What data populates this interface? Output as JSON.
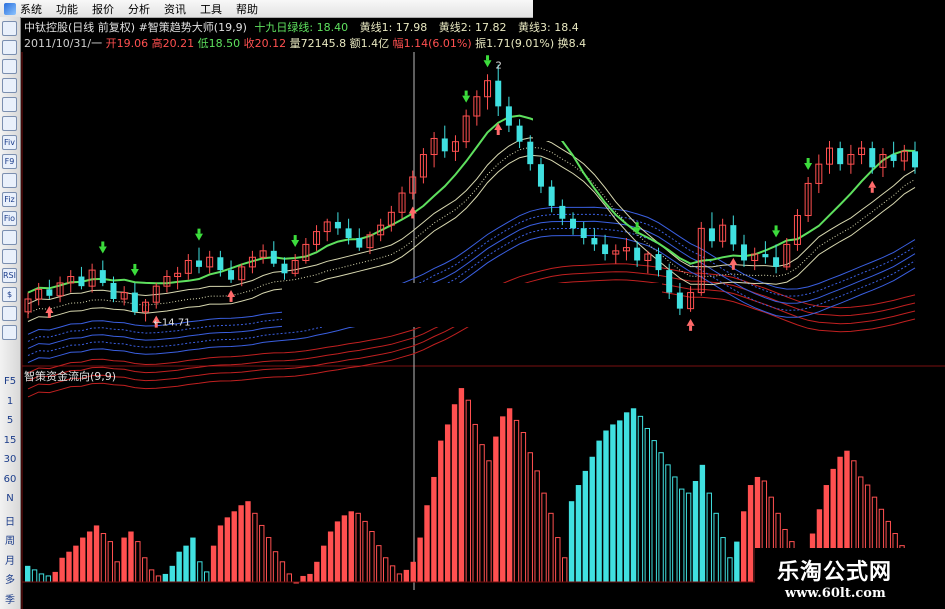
{
  "menu": {
    "items": [
      "系统",
      "功能",
      "报价",
      "分析",
      "资讯",
      "工具",
      "帮助"
    ]
  },
  "toolbar": {
    "labels": [
      "F5",
      "1",
      "5",
      "15",
      "30",
      "60",
      "N",
      "日",
      "周",
      "月",
      "多",
      "季"
    ],
    "icon_text": [
      "",
      "",
      "",
      "",
      "",
      "",
      "Fiv",
      "F9",
      "",
      "Fiz",
      "Fio",
      "",
      "",
      "RSI",
      "$",
      "",
      ""
    ]
  },
  "header": {
    "line1": {
      "stock": "中钛控股(日线 前复权)",
      "indicator": "#智策趋势大师(19,9)",
      "green_line": "十九日绿线: 18.40",
      "yellow1": "黄线1: 17.98",
      "yellow2": "黄线2: 17.82",
      "yellow3": "黄线3: 18.4"
    },
    "line2": {
      "date": "2011/10/31/一",
      "open": "开19.06",
      "high": "高20.21",
      "low": "低18.50",
      "close": "收20.12",
      "volume": "量72145.8",
      "amount": "额1.4亿",
      "change": "幅1.14(6.01%)",
      "amplitude": "振1.71(9.01%)",
      "turnover": "换8.4"
    }
  },
  "lower_panel": {
    "title": "智策资金流向(9,9)"
  },
  "annotations": {
    "low_price": "14.71",
    "high_price_partial": "2"
  },
  "watermark": {
    "title": "乐淘公式网",
    "url": "www.60lt.com"
  },
  "colors": {
    "up": "#ff5050",
    "down": "#40e0e0",
    "green_line": "#5ee05e",
    "yellow_line": "#d8d8b0",
    "blue_band": "#3a5fe0",
    "red_band": "#c02020",
    "arrow_down": "#3cdc3c",
    "arrow_up": "#ff6a6a"
  },
  "chart_data": [
    {
      "type": "candlestick",
      "title": "#智策趋势大师(19,9)",
      "ylim": [
        13.5,
        23
      ],
      "candles": [
        {
          "o": 15.0,
          "h": 15.6,
          "l": 14.8,
          "c": 15.4
        },
        {
          "o": 15.4,
          "h": 15.9,
          "l": 15.2,
          "c": 15.7
        },
        {
          "o": 15.7,
          "h": 16.0,
          "l": 15.4,
          "c": 15.5
        },
        {
          "o": 15.5,
          "h": 16.1,
          "l": 15.3,
          "c": 15.9
        },
        {
          "o": 15.9,
          "h": 16.3,
          "l": 15.6,
          "c": 16.1
        },
        {
          "o": 16.1,
          "h": 16.4,
          "l": 15.7,
          "c": 15.8
        },
        {
          "o": 15.8,
          "h": 16.5,
          "l": 15.6,
          "c": 16.3
        },
        {
          "o": 16.3,
          "h": 16.6,
          "l": 15.8,
          "c": 15.9
        },
        {
          "o": 15.9,
          "h": 16.1,
          "l": 15.3,
          "c": 15.4
        },
        {
          "o": 15.4,
          "h": 15.8,
          "l": 15.2,
          "c": 15.6
        },
        {
          "o": 15.6,
          "h": 15.9,
          "l": 14.9,
          "c": 15.0
        },
        {
          "o": 15.0,
          "h": 15.4,
          "l": 14.7,
          "c": 15.3
        },
        {
          "o": 15.3,
          "h": 15.9,
          "l": 15.1,
          "c": 15.8
        },
        {
          "o": 15.8,
          "h": 16.3,
          "l": 15.6,
          "c": 16.1
        },
        {
          "o": 16.1,
          "h": 16.4,
          "l": 15.7,
          "c": 16.2
        },
        {
          "o": 16.2,
          "h": 16.8,
          "l": 16.0,
          "c": 16.6
        },
        {
          "o": 16.6,
          "h": 17.0,
          "l": 16.2,
          "c": 16.4
        },
        {
          "o": 16.4,
          "h": 16.9,
          "l": 16.2,
          "c": 16.7
        },
        {
          "o": 16.7,
          "h": 16.9,
          "l": 16.1,
          "c": 16.3
        },
        {
          "o": 16.3,
          "h": 16.6,
          "l": 15.9,
          "c": 16.0
        },
        {
          "o": 16.0,
          "h": 16.5,
          "l": 15.8,
          "c": 16.4
        },
        {
          "o": 16.4,
          "h": 16.9,
          "l": 16.2,
          "c": 16.7
        },
        {
          "o": 16.7,
          "h": 17.1,
          "l": 16.5,
          "c": 16.9
        },
        {
          "o": 16.9,
          "h": 17.2,
          "l": 16.4,
          "c": 16.5
        },
        {
          "o": 16.5,
          "h": 16.7,
          "l": 16.0,
          "c": 16.2
        },
        {
          "o": 16.2,
          "h": 16.8,
          "l": 16.1,
          "c": 16.6
        },
        {
          "o": 16.6,
          "h": 17.3,
          "l": 16.5,
          "c": 17.1
        },
        {
          "o": 17.1,
          "h": 17.7,
          "l": 16.9,
          "c": 17.5
        },
        {
          "o": 17.5,
          "h": 17.9,
          "l": 17.2,
          "c": 17.8
        },
        {
          "o": 17.8,
          "h": 18.1,
          "l": 17.4,
          "c": 17.6
        },
        {
          "o": 17.6,
          "h": 17.9,
          "l": 17.1,
          "c": 17.3
        },
        {
          "o": 17.3,
          "h": 17.6,
          "l": 16.9,
          "c": 17.0
        },
        {
          "o": 17.0,
          "h": 17.5,
          "l": 16.8,
          "c": 17.4
        },
        {
          "o": 17.4,
          "h": 17.9,
          "l": 17.2,
          "c": 17.7
        },
        {
          "o": 17.7,
          "h": 18.3,
          "l": 17.5,
          "c": 18.1
        },
        {
          "o": 18.1,
          "h": 18.9,
          "l": 17.9,
          "c": 18.7
        },
        {
          "o": 18.7,
          "h": 19.4,
          "l": 18.5,
          "c": 19.2
        },
        {
          "o": 19.2,
          "h": 20.1,
          "l": 19.0,
          "c": 19.9
        },
        {
          "o": 19.9,
          "h": 20.6,
          "l": 19.5,
          "c": 20.4
        },
        {
          "o": 20.4,
          "h": 20.8,
          "l": 19.8,
          "c": 20.0
        },
        {
          "o": 20.0,
          "h": 20.5,
          "l": 19.7,
          "c": 20.3
        },
        {
          "o": 20.3,
          "h": 21.3,
          "l": 20.1,
          "c": 21.1
        },
        {
          "o": 21.1,
          "h": 21.9,
          "l": 20.8,
          "c": 21.7
        },
        {
          "o": 21.7,
          "h": 22.4,
          "l": 21.3,
          "c": 22.2
        },
        {
          "o": 22.2,
          "h": 22.7,
          "l": 21.1,
          "c": 21.4
        },
        {
          "o": 21.4,
          "h": 21.7,
          "l": 20.6,
          "c": 20.8
        },
        {
          "o": 20.8,
          "h": 21.0,
          "l": 20.1,
          "c": 20.3
        },
        {
          "o": 20.3,
          "h": 20.5,
          "l": 19.4,
          "c": 19.6
        },
        {
          "o": 19.6,
          "h": 19.8,
          "l": 18.7,
          "c": 18.9
        },
        {
          "o": 18.9,
          "h": 19.1,
          "l": 18.1,
          "c": 18.3
        },
        {
          "o": 18.3,
          "h": 18.5,
          "l": 17.7,
          "c": 17.9
        },
        {
          "o": 17.9,
          "h": 18.1,
          "l": 17.4,
          "c": 17.6
        },
        {
          "o": 17.6,
          "h": 17.8,
          "l": 17.1,
          "c": 17.3
        },
        {
          "o": 17.3,
          "h": 17.6,
          "l": 16.9,
          "c": 17.1
        },
        {
          "o": 17.1,
          "h": 17.4,
          "l": 16.6,
          "c": 16.8
        },
        {
          "o": 16.8,
          "h": 17.1,
          "l": 16.5,
          "c": 16.9
        },
        {
          "o": 16.9,
          "h": 17.3,
          "l": 16.6,
          "c": 17.0
        },
        {
          "o": 17.0,
          "h": 17.2,
          "l": 16.4,
          "c": 16.6
        },
        {
          "o": 16.6,
          "h": 16.9,
          "l": 16.2,
          "c": 16.8
        },
        {
          "o": 16.8,
          "h": 17.0,
          "l": 16.1,
          "c": 16.3
        },
        {
          "o": 16.3,
          "h": 16.5,
          "l": 15.4,
          "c": 15.6
        },
        {
          "o": 15.6,
          "h": 15.9,
          "l": 14.9,
          "c": 15.1
        },
        {
          "o": 15.1,
          "h": 15.8,
          "l": 15.0,
          "c": 15.6
        },
        {
          "o": 15.6,
          "h": 17.8,
          "l": 15.5,
          "c": 17.6
        },
        {
          "o": 17.6,
          "h": 18.1,
          "l": 17.0,
          "c": 17.2
        },
        {
          "o": 17.2,
          "h": 17.9,
          "l": 17.0,
          "c": 17.7
        },
        {
          "o": 17.7,
          "h": 18.0,
          "l": 16.9,
          "c": 17.1
        },
        {
          "o": 17.1,
          "h": 17.4,
          "l": 16.4,
          "c": 16.6
        },
        {
          "o": 16.6,
          "h": 17.0,
          "l": 16.3,
          "c": 16.8
        },
        {
          "o": 16.8,
          "h": 17.2,
          "l": 16.5,
          "c": 16.7
        },
        {
          "o": 16.7,
          "h": 17.1,
          "l": 16.2,
          "c": 16.4
        },
        {
          "o": 16.4,
          "h": 17.3,
          "l": 16.3,
          "c": 17.1
        },
        {
          "o": 17.1,
          "h": 18.2,
          "l": 16.9,
          "c": 18.0
        },
        {
          "o": 18.0,
          "h": 19.2,
          "l": 17.8,
          "c": 19.0
        },
        {
          "o": 19.0,
          "h": 19.9,
          "l": 18.7,
          "c": 19.6
        },
        {
          "o": 19.6,
          "h": 20.4,
          "l": 19.3,
          "c": 20.1
        },
        {
          "o": 20.1,
          "h": 20.3,
          "l": 19.4,
          "c": 19.6
        },
        {
          "o": 19.6,
          "h": 20.2,
          "l": 19.3,
          "c": 19.9
        },
        {
          "o": 19.9,
          "h": 20.4,
          "l": 19.6,
          "c": 20.1
        },
        {
          "o": 20.1,
          "h": 20.3,
          "l": 19.3,
          "c": 19.5
        },
        {
          "o": 19.5,
          "h": 20.1,
          "l": 19.2,
          "c": 19.9
        },
        {
          "o": 19.9,
          "h": 20.3,
          "l": 19.5,
          "c": 19.7
        },
        {
          "o": 19.7,
          "h": 20.2,
          "l": 19.4,
          "c": 20.0
        },
        {
          "o": 20.0,
          "h": 20.3,
          "l": 19.3,
          "c": 19.5
        }
      ]
    },
    {
      "type": "bar",
      "title": "智策资金流向(9,9)",
      "ylim": [
        0,
        100
      ],
      "values": [
        8,
        6,
        4,
        3,
        5,
        12,
        15,
        18,
        22,
        25,
        28,
        24,
        20,
        10,
        22,
        25,
        20,
        12,
        6,
        3,
        4,
        8,
        15,
        18,
        22,
        10,
        5,
        18,
        28,
        32,
        35,
        38,
        40,
        34,
        28,
        22,
        15,
        10,
        4,
        0,
        3,
        4,
        10,
        18,
        25,
        30,
        33,
        35,
        34,
        30,
        25,
        18,
        12,
        8,
        4,
        6,
        10,
        22,
        38,
        52,
        70,
        78,
        88,
        96,
        90,
        78,
        68,
        60,
        72,
        82,
        86,
        80,
        74,
        64,
        55,
        44,
        34,
        22,
        12,
        40,
        48,
        55,
        62,
        70,
        75,
        78,
        80,
        84,
        86,
        82,
        76,
        70,
        64,
        58,
        52,
        46,
        44,
        50,
        58,
        44,
        34,
        22,
        12,
        20,
        35,
        48,
        52,
        50,
        42,
        34,
        26,
        20,
        16,
        12,
        24,
        36,
        48,
        56,
        62,
        65,
        60,
        52,
        48,
        42,
        36,
        30,
        24,
        18,
        14,
        10
      ]
    }
  ]
}
